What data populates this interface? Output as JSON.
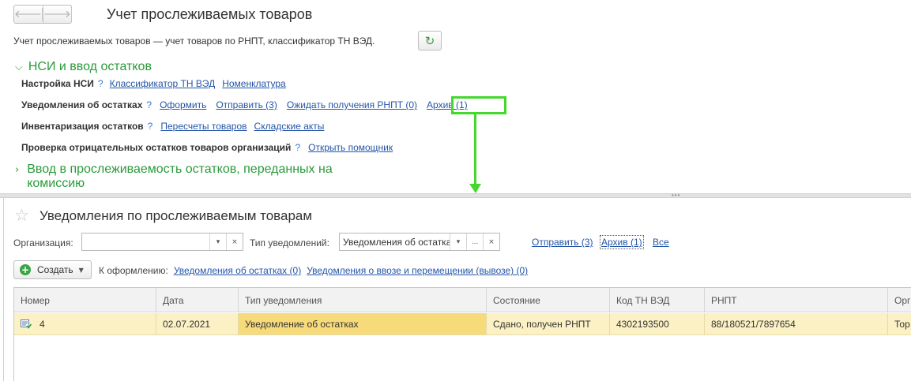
{
  "nav": {
    "back_icon": "arrow-left-icon",
    "forward_icon": "arrow-right-icon"
  },
  "page": {
    "title": "Учет прослеживаемых товаров",
    "subtitle": "Учет прослеживаемых товаров — учет товаров по РНПТ, классификатор ТН ВЭД."
  },
  "nsi_group": {
    "title": "НСИ и ввод остатков",
    "rows": [
      {
        "label": "Настройка НСИ",
        "links": [
          "Классификатор ТН ВЭД",
          "Номенклатура"
        ]
      },
      {
        "label": "Уведомления об остатках",
        "links": [
          "Оформить",
          "Отправить (3)",
          "Ожидать получения РНПТ (0)",
          "Архив (1)"
        ]
      },
      {
        "label": "Инвентаризация остатков",
        "links": [
          "Пересчеты товаров",
          "Складские акты"
        ]
      },
      {
        "label": "Проверка отрицательных остатков товаров организаций",
        "links": [
          "Открыть помощник"
        ]
      }
    ],
    "help_mark": "?"
  },
  "commission_group": {
    "title": "Ввод в прослеживаемость остатков, переданных на комиссию"
  },
  "list": {
    "title": "Уведомления по прослеживаемым товарам",
    "filters": {
      "org_label": "Организация:",
      "org_value": "",
      "type_label": "Тип уведомлений:",
      "type_value": "Уведомления об остатках",
      "dropdown_glyph": "▾",
      "clear_glyph": "×",
      "more_glyph": "..."
    },
    "links": {
      "send": "Отправить (3)",
      "archive": "Архив (1)",
      "all": "Все"
    },
    "create_label": "Создать",
    "todo": {
      "label": "К оформлению:",
      "links": [
        "Уведомления об остатках (0)",
        "Уведомления о ввозе и перемещении (вывозе) (0)"
      ]
    }
  },
  "table": {
    "columns": [
      "Номер",
      "Дата",
      "Тип уведомления",
      "Состояние",
      "Код ТН ВЭД",
      "РНПТ",
      "Орг"
    ],
    "rows": [
      [
        "4",
        "02.07.2021",
        "Уведомление об остатках",
        "Сдано, получен РНПТ",
        "4302193500",
        "88/180521/7897654",
        "Тор"
      ]
    ]
  },
  "annotation": {
    "highlight_color": "#44d82d"
  }
}
